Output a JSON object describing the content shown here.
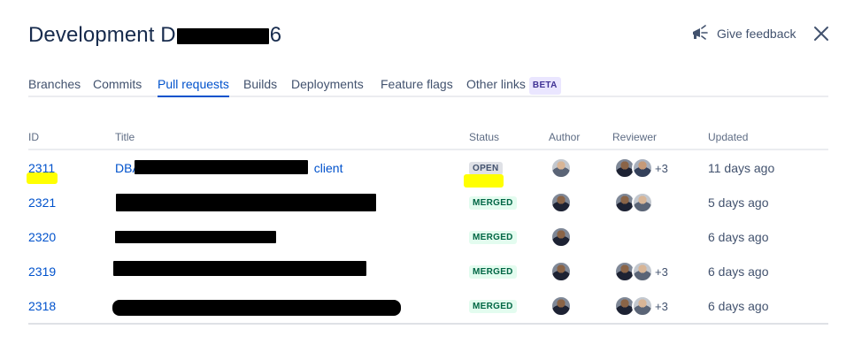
{
  "header": {
    "title_prefix": "Development D",
    "title_suffix": "6",
    "feedback_label": "Give feedback",
    "close_icon": "close-icon",
    "feedback_icon": "megaphone-icon"
  },
  "tabs": [
    {
      "label": "Branches",
      "active": false
    },
    {
      "label": "Commits",
      "active": false
    },
    {
      "label": "Pull requests",
      "active": true
    },
    {
      "label": "Builds",
      "active": false
    },
    {
      "label": "Deployments",
      "active": false
    },
    {
      "label": "Feature flags",
      "active": false
    },
    {
      "label": "Other links",
      "active": false,
      "badge": "BETA"
    }
  ],
  "table": {
    "columns": [
      "ID",
      "Title",
      "Status",
      "Author",
      "Reviewer",
      "Updated"
    ],
    "rows": [
      {
        "id": "2311",
        "title_prefix": "DBA",
        "title_suffix": "client",
        "status": "OPEN",
        "reviewers_more": "+3",
        "updated": "11 days ago"
      },
      {
        "id": "2321",
        "title_prefix": "",
        "title_suffix": "",
        "status": "MERGED",
        "reviewers_more": "",
        "updated": "5 days ago"
      },
      {
        "id": "2320",
        "title_prefix": "",
        "title_suffix": "",
        "status": "MERGED",
        "reviewers_more": "",
        "updated": "6 days ago"
      },
      {
        "id": "2319",
        "title_prefix": "",
        "title_suffix": "",
        "status": "MERGED",
        "reviewers_more": "+3",
        "updated": "6 days ago"
      },
      {
        "id": "2318",
        "title_prefix": "",
        "title_suffix": "",
        "status": "MERGED",
        "reviewers_more": "+3",
        "updated": "6 days ago"
      }
    ]
  },
  "colors": {
    "link": "#0052cc",
    "text": "#172b4d",
    "muted": "#5e6c84",
    "open_badge_bg": "#dfe1e6",
    "merged_badge_bg": "#e3fcef",
    "merged_badge_text": "#006644",
    "highlight": "#ffff00"
  }
}
